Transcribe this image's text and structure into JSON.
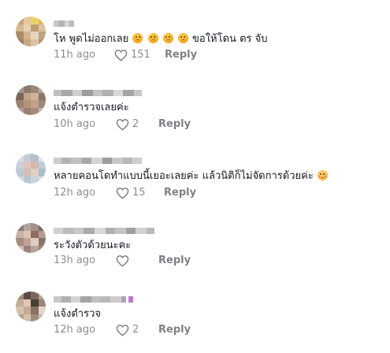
{
  "comments": [
    {
      "text_before": "โห พูดไม่ออกเลย ",
      "text_after": " ขอให้โดน ตร จับ",
      "time": "11h ago",
      "likes": "151",
      "reply_label": "Reply",
      "emojis": [
        "sad-face-icon",
        "sad-face-icon",
        "sad-face-icon",
        "sad-face-icon"
      ]
    },
    {
      "text": "แจ้งตำรวจเลยค่ะ",
      "time": "10h ago",
      "likes": "2",
      "reply_label": "Reply"
    },
    {
      "text": "หลายคอนโดทำแบบนี้เยอะเลยค่ะ แล้วนิติก็ไม่จัดการด้วยค่ะ ",
      "time": "12h ago",
      "likes": "15",
      "reply_label": "Reply",
      "emojis": [
        "smiling-face-icon"
      ]
    },
    {
      "text": "ระวังตัวด้วยนะคะ",
      "time": "13h ago",
      "likes": "",
      "reply_label": "Reply"
    },
    {
      "text": "แจ้งตำรวจ",
      "time": "12h ago",
      "likes": "2",
      "reply_label": "Reply"
    }
  ],
  "colors": {
    "text": "#161823",
    "meta": "#8a8b91",
    "reply": "#7c7d83"
  }
}
